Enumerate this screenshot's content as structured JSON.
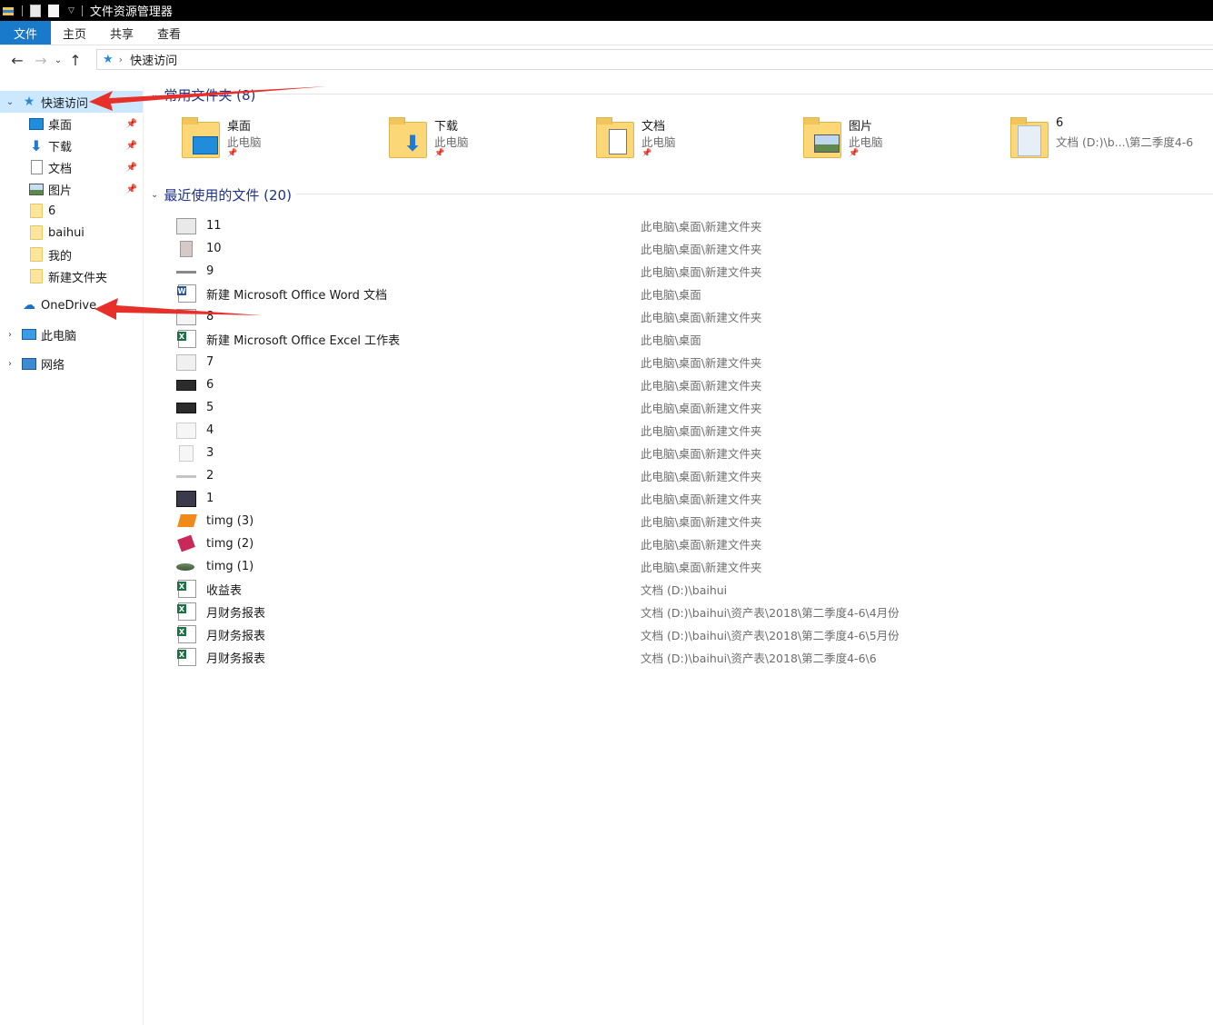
{
  "window": {
    "title": "文件资源管理器"
  },
  "ribbon": {
    "tabs": [
      "文件",
      "主页",
      "共享",
      "查看"
    ]
  },
  "address": {
    "path": "快速访问"
  },
  "nav": {
    "quick_access": "快速访问",
    "pinned": [
      {
        "label": "桌面",
        "icon": "desktop-icon"
      },
      {
        "label": "下载",
        "icon": "download-icon"
      },
      {
        "label": "文档",
        "icon": "document-icon"
      },
      {
        "label": "图片",
        "icon": "pictures-icon"
      }
    ],
    "recent_folders": [
      "6",
      "baihui",
      "我的",
      "新建文件夹"
    ],
    "onedrive": "OneDrive",
    "this_pc": "此电脑",
    "network": "网络"
  },
  "frequent": {
    "header": "常用文件夹 (8)",
    "tiles": [
      {
        "name": "桌面",
        "sub": "此电脑"
      },
      {
        "name": "下载",
        "sub": "此电脑"
      },
      {
        "name": "文档",
        "sub": "此电脑"
      },
      {
        "name": "图片",
        "sub": "此电脑"
      },
      {
        "name": "6",
        "sub": "文档 (D:)\\b...\\第二季度4-6"
      }
    ]
  },
  "recent": {
    "header": "最近使用的文件 (20)",
    "files": [
      {
        "name": "11",
        "path": "此电脑\\桌面\\新建文件夹"
      },
      {
        "name": "10",
        "path": "此电脑\\桌面\\新建文件夹"
      },
      {
        "name": "9",
        "path": "此电脑\\桌面\\新建文件夹"
      },
      {
        "name": "新建 Microsoft Office Word 文档",
        "path": "此电脑\\桌面"
      },
      {
        "name": "8",
        "path": "此电脑\\桌面\\新建文件夹"
      },
      {
        "name": "新建 Microsoft Office Excel 工作表",
        "path": "此电脑\\桌面"
      },
      {
        "name": "7",
        "path": "此电脑\\桌面\\新建文件夹"
      },
      {
        "name": "6",
        "path": "此电脑\\桌面\\新建文件夹"
      },
      {
        "name": "5",
        "path": "此电脑\\桌面\\新建文件夹"
      },
      {
        "name": "4",
        "path": "此电脑\\桌面\\新建文件夹"
      },
      {
        "name": "3",
        "path": "此电脑\\桌面\\新建文件夹"
      },
      {
        "name": "2",
        "path": "此电脑\\桌面\\新建文件夹"
      },
      {
        "name": "1",
        "path": "此电脑\\桌面\\新建文件夹"
      },
      {
        "name": "timg (3)",
        "path": "此电脑\\桌面\\新建文件夹"
      },
      {
        "name": "timg (2)",
        "path": "此电脑\\桌面\\新建文件夹"
      },
      {
        "name": "timg (1)",
        "path": "此电脑\\桌面\\新建文件夹"
      },
      {
        "name": "收益表",
        "path": "文档 (D:)\\baihui"
      },
      {
        "name": "月财务报表",
        "path": "文档 (D:)\\baihui\\资产表\\2018\\第二季度4-6\\4月份"
      },
      {
        "name": "月财务报表",
        "path": "文档 (D:)\\baihui\\资产表\\2018\\第二季度4-6\\5月份"
      },
      {
        "name": "月财务报表",
        "path": "文档 (D:)\\baihui\\资产表\\2018\\第二季度4-6\\6"
      }
    ]
  },
  "colors": {
    "accent": "#1979ca",
    "selection": "#cce8ff",
    "annotation_arrow": "#e8302a"
  }
}
